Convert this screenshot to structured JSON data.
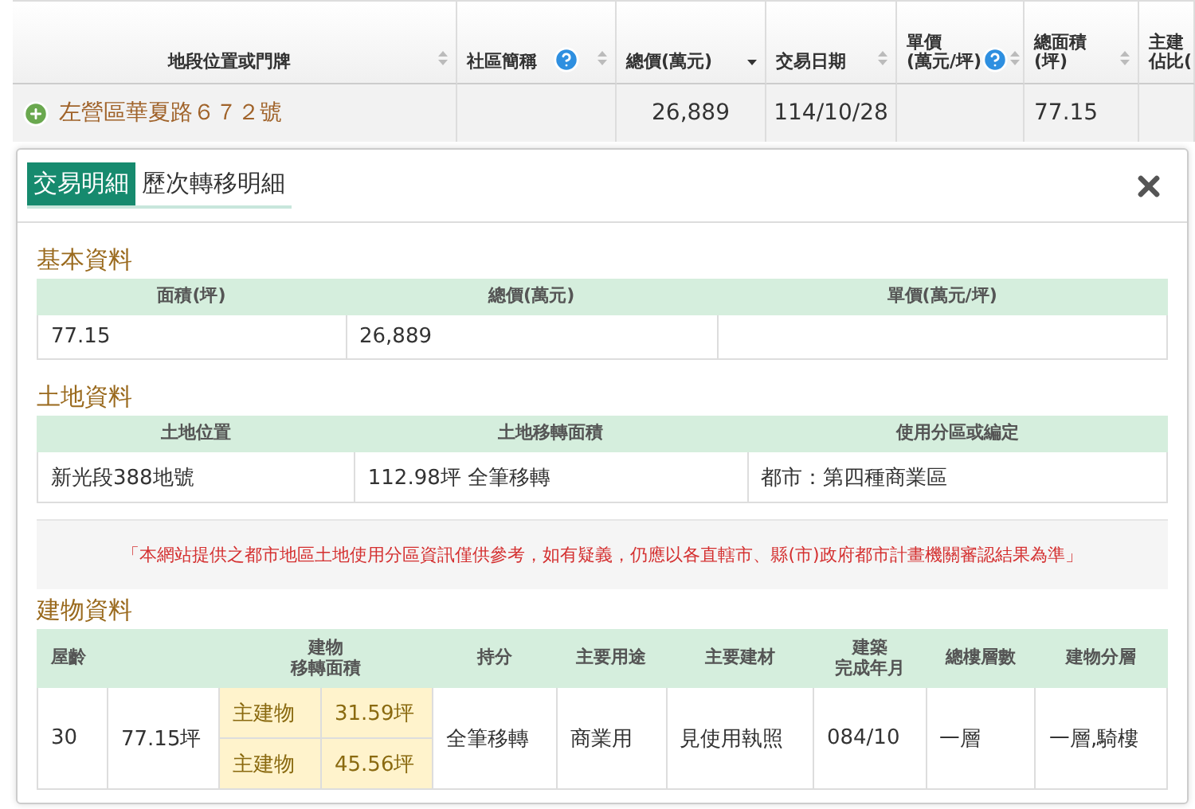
{
  "list_table": {
    "columns": [
      {
        "lines": [
          "地段位置或門牌"
        ],
        "help": false,
        "sorted": false
      },
      {
        "lines": [
          "社區簡稱"
        ],
        "help": true,
        "sorted": false
      },
      {
        "lines": [
          "總價(萬元)"
        ],
        "help": false,
        "sorted": true
      },
      {
        "lines": [
          "交易日期"
        ],
        "help": false,
        "sorted": false
      },
      {
        "lines": [
          "單價",
          "(萬元/坪)"
        ],
        "help": true,
        "sorted": false
      },
      {
        "lines": [
          "總面積",
          "(坪)"
        ],
        "help": false,
        "sorted": false
      },
      {
        "lines": [
          "主建",
          "佔比("
        ],
        "help": false
      }
    ],
    "rows": [
      {
        "expanded": false,
        "address": "左營區華夏路６７２號",
        "total": "26,889",
        "date": "114/10/28",
        "area": "77.15"
      }
    ]
  },
  "detail": {
    "tabs": [
      {
        "label": "交易明細",
        "selected": true
      },
      {
        "label": "歷次轉移明細",
        "selected": false
      }
    ],
    "basic": {
      "title": "基本資料",
      "columns": [
        "面積(坪)",
        "總價(萬元)",
        "單價(萬元/坪)"
      ],
      "row": [
        "77.15",
        "26,889"
      ]
    },
    "land": {
      "title": "土地資料",
      "columns": [
        "土地位置",
        "土地移轉面積",
        "使用分區或編定"
      ],
      "row": [
        "新光段388地號",
        "112.98坪 全筆移轉",
        "都市：第四種商業區"
      ]
    },
    "notice": "「本網站提供之都市地區土地使用分區資訊僅供參考，如有疑義，仍應以各直轄市、縣(市)政府都市計畫機關審認結果為準」",
    "building": {
      "title": "建物資料",
      "columns": [
        [
          "屋齡"
        ],
        [
          "建物",
          "移轉面積"
        ],
        [
          "持分"
        ],
        [
          "主要用途"
        ],
        [
          "主要建材"
        ],
        [
          "建築",
          "完成年月"
        ],
        [
          "總樓層數"
        ],
        [
          "建物分層"
        ]
      ],
      "row": {
        "age": "30",
        "area": "77.15坪",
        "parts": [
          {
            "type": "主建物",
            "area": "31.59坪"
          },
          {
            "type": "主建物",
            "area": "45.56坪"
          }
        ],
        "share": "全筆移轉",
        "use": "商業用",
        "material": "見使用執照",
        "completed": "084/10",
        "floors": "一層",
        "layers": "一層,騎樓"
      }
    }
  }
}
